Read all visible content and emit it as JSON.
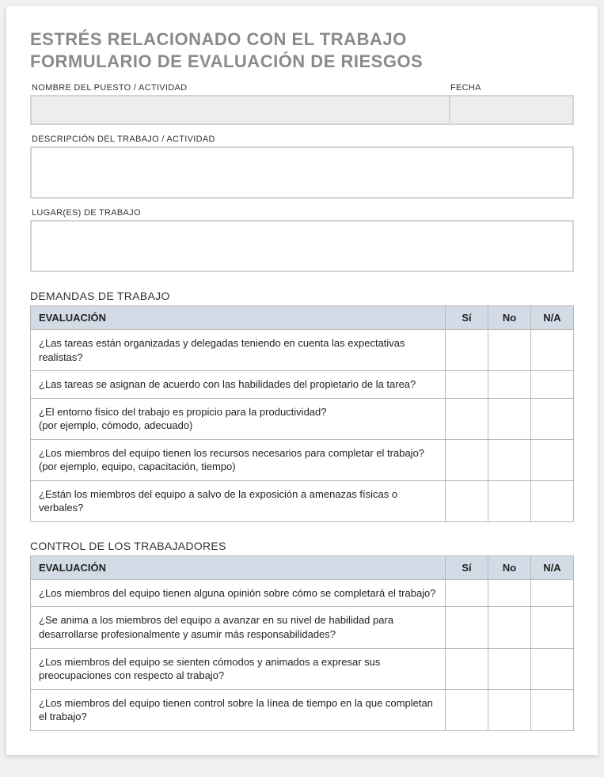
{
  "title_line1": "ESTRÉS RELACIONADO CON EL TRABAJO",
  "title_line2": "FORMULARIO DE EVALUACIÓN DE RIESGOS",
  "fields": {
    "name_label": "NOMBRE DEL PUESTO / ACTIVIDAD",
    "date_label": "FECHA",
    "desc_label": "DESCRIPCIÓN DEL TRABAJO / ACTIVIDAD",
    "place_label": "LUGAR(ES) DE TRABAJO",
    "name_value": "",
    "date_value": "",
    "desc_value": "",
    "place_value": ""
  },
  "columns": {
    "eval": "EVALUACIÓN",
    "yes": "Sí",
    "no": "No",
    "na": "N/A"
  },
  "section1": {
    "title": "DEMANDAS DE TRABAJO",
    "rows": [
      "¿Las tareas están organizadas y delegadas teniendo en cuenta las expectativas realistas?",
      "¿Las tareas se asignan de acuerdo con las habilidades del propietario de la tarea?",
      "¿El entorno físico del trabajo es propicio para la productividad?\n(por ejemplo, cómodo, adecuado)",
      "¿Los miembros del equipo tienen los recursos necesarios para completar el trabajo?\n(por ejemplo, equipo, capacitación, tiempo)",
      "¿Están los miembros del equipo a salvo de la exposición a amenazas físicas o verbales?"
    ]
  },
  "section2": {
    "title": "CONTROL DE LOS TRABAJADORES",
    "rows": [
      "¿Los miembros del equipo tienen alguna opinión sobre cómo se completará el trabajo?",
      "¿Se anima a los miembros del equipo a avanzar en su nivel de habilidad para desarrollarse profesionalmente y asumir más responsabilidades?",
      "¿Los miembros del equipo se sienten cómodos y animados a expresar sus preocupaciones con respecto al trabajo?",
      "¿Los miembros del equipo tienen control sobre la línea de tiempo en la que completan el trabajo?"
    ]
  }
}
